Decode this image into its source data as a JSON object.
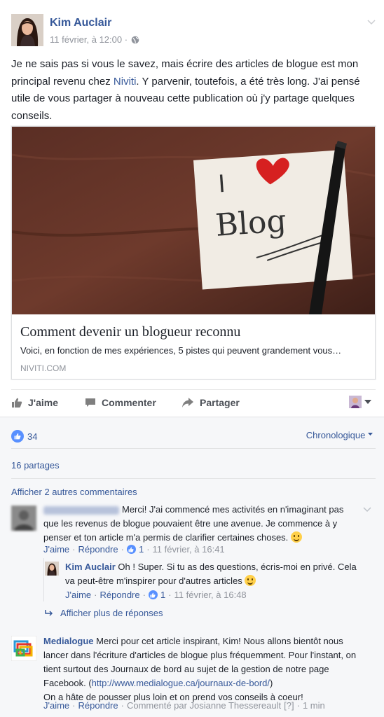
{
  "post": {
    "author": "Kim Auclair",
    "timestamp": "11 février, à 12:00 ·",
    "privacy_icon": "globe-icon",
    "text_parts": {
      "before_link": "Je ne sais pas si vous le savez, mais écrire des articles de blogue est mon principal revenu chez ",
      "link": "Niviti",
      "after_link": ". Y parvenir, toutefois, a été très long. J'ai pensé utile de vous partager à nouveau cette publication où j'y partage quelques conseils."
    }
  },
  "card": {
    "image_text": "I Blog",
    "title": "Comment devenir un blogueur reconnu",
    "description": "Voici, en fonction de mes expériences, 5 pistes qui peuvent grandement vous…",
    "domain": "NIVITI.COM"
  },
  "actions": {
    "like": "J'aime",
    "comment": "Commenter",
    "share": "Partager"
  },
  "summary": {
    "likes_count": "34",
    "order": "Chronologique",
    "shares": "16 partages",
    "more_comments": "Afficher 2 autres commentaires",
    "show_replies": "Afficher plus de réponses"
  },
  "comments": [
    {
      "name": "",
      "text": "Merci! J'ai commencé mes activités en n'imaginant pas que les revenus de blogue pouvaient être une avenue. Je commence à y penser et ton article m'a permis de clarifier certaines choses.",
      "like": "J'aime",
      "reply": "Répondre",
      "likes": "1",
      "time": "11 février, à 16:41"
    },
    {
      "name": "Kim Auclair",
      "text": "Oh ! Super. Si tu as des questions, écris-moi en privé. Cela va peut-être m'inspirer pour d'autres articles",
      "like": "J'aime",
      "reply": "Répondre",
      "likes": "1",
      "time": "11 février, à 16:48"
    },
    {
      "name": "Medialogue",
      "text": "Merci pour cet article inspirant, Kim! Nous allons bientôt nous lancer dans l'écriture d'articles de blogue plus fréquemment. Pour l'instant, on tient surtout des Journaux de bord au sujet de la gestion de notre page Facebook. (",
      "link": "http://www.medialogue.ca/journaux-de-bord/",
      "text_after": ")",
      "text2": "On a hâte de pousser plus loin et on prend vos conseils à coeur!",
      "like": "J'aime",
      "reply": "Répondre",
      "edited": "Commenté par Josianne Thessereault",
      "edited_marker": "[?]",
      "time": "1 min"
    }
  ],
  "colors": {
    "link": "#365899",
    "like_blue": "#5890ff",
    "muted": "#90949c"
  }
}
